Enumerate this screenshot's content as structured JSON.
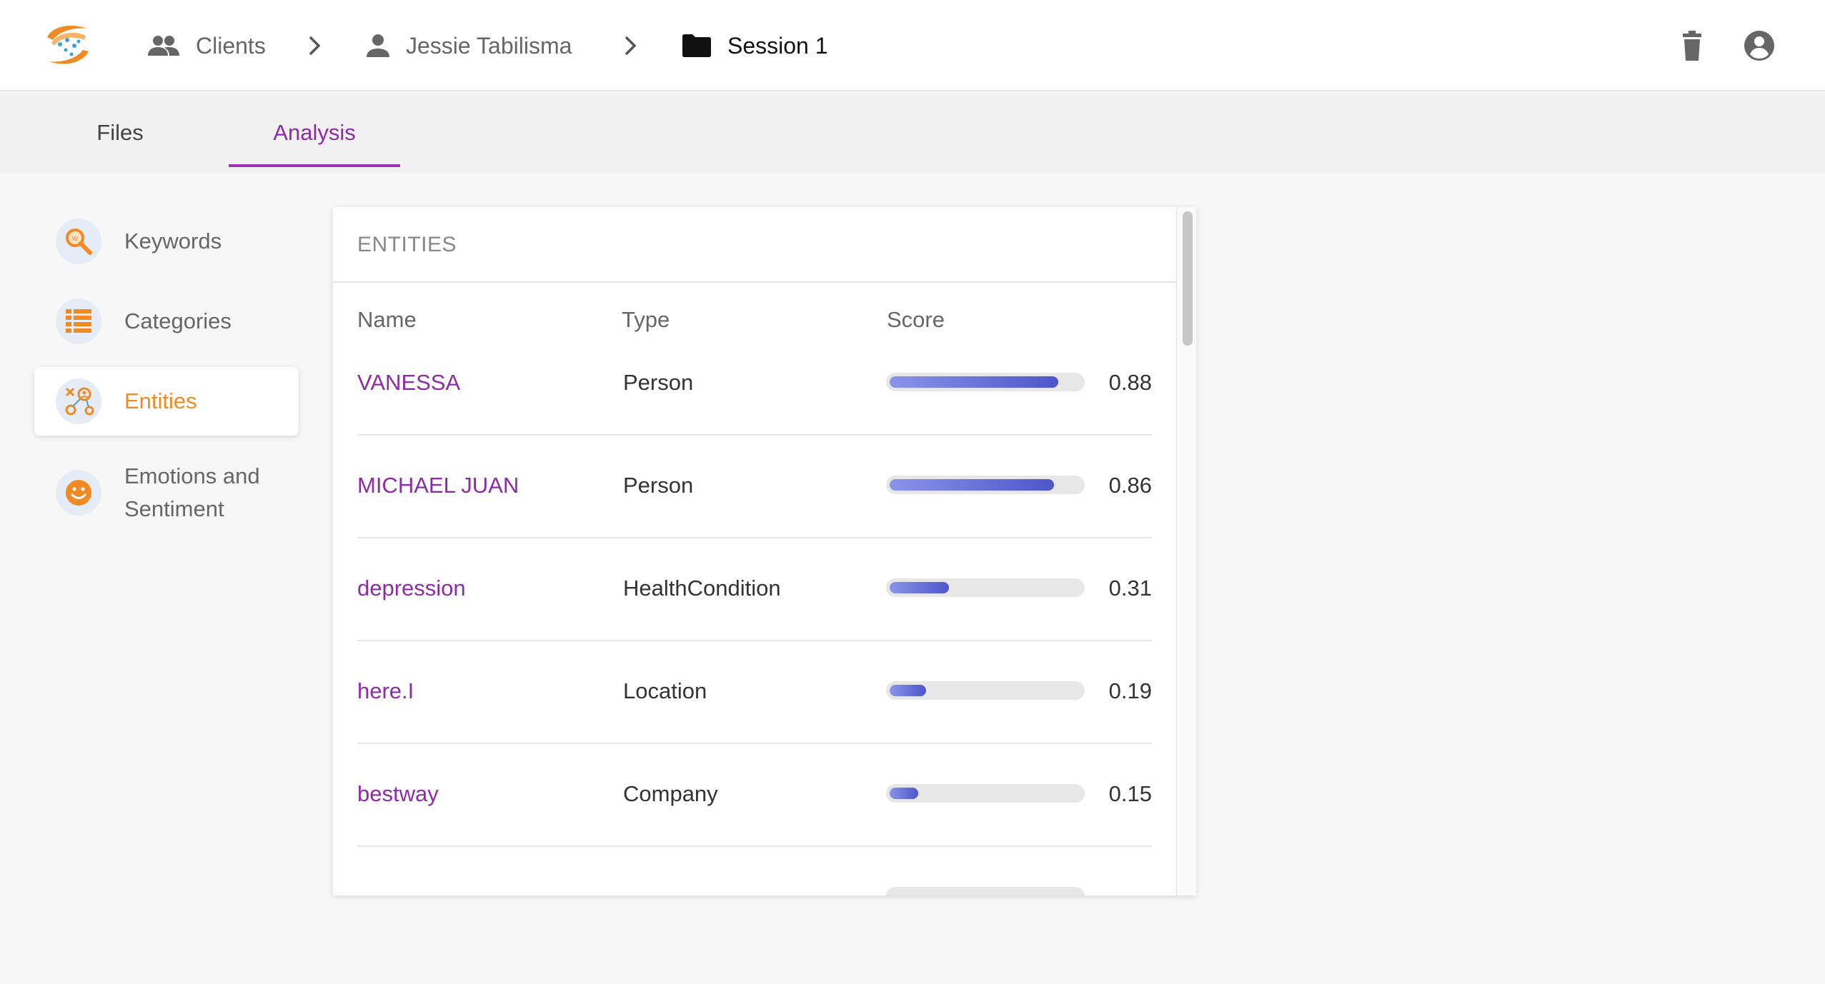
{
  "header": {
    "breadcrumbs": [
      {
        "label": "Clients",
        "icon": "people-icon"
      },
      {
        "label": "Jessie Tabilisma",
        "icon": "person-icon"
      },
      {
        "label": "Session 1",
        "icon": "folder-icon"
      }
    ],
    "separator_icon": "chevron-right-icon",
    "actions": [
      {
        "icon": "trash-icon"
      },
      {
        "icon": "account-circle-icon"
      }
    ]
  },
  "tabs": [
    {
      "label": "Files",
      "active": false
    },
    {
      "label": "Analysis",
      "active": true
    }
  ],
  "sidebar": {
    "items": [
      {
        "label": "Keywords",
        "icon": "keyword-search-icon",
        "active": false
      },
      {
        "label": "Categories",
        "icon": "categories-list-icon",
        "active": false
      },
      {
        "label": "Entities",
        "icon": "entities-icon",
        "active": true
      },
      {
        "label": "Emotions and Sentiment",
        "icon": "smiley-icon",
        "active": false
      }
    ]
  },
  "entities": {
    "title": "ENTITIES",
    "columns": [
      "Name",
      "Type",
      "Score"
    ],
    "rows": [
      {
        "name": "VANESSA",
        "type": "Person",
        "score": "0.88",
        "value": 0.88
      },
      {
        "name": "MICHAEL JUAN",
        "type": "Person",
        "score": "0.86",
        "value": 0.86
      },
      {
        "name": "depression",
        "type": "HealthCondition",
        "score": "0.31",
        "value": 0.31
      },
      {
        "name": "here.I",
        "type": "Location",
        "score": "0.19",
        "value": 0.19
      },
      {
        "name": "bestway",
        "type": "Company",
        "score": "0.15",
        "value": 0.15
      }
    ]
  },
  "colors": {
    "accent_purple": "#8e2ca6",
    "accent_orange": "#f08a24",
    "bar_gradient_start": "#8a94ea",
    "bar_gradient_end": "#4d56c9"
  }
}
